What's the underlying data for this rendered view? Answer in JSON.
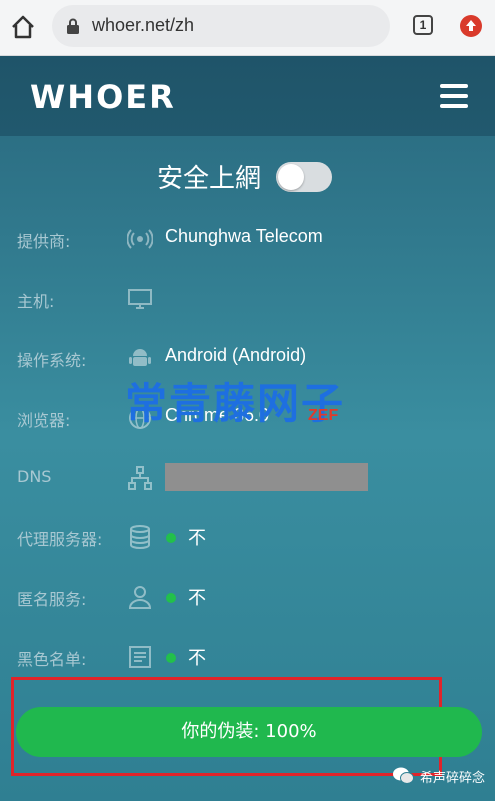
{
  "browser": {
    "url": "whoer.net/zh",
    "tab_count": "1"
  },
  "site": {
    "logo": "WHOER"
  },
  "secure": {
    "label": "安全上網",
    "toggle_on": false
  },
  "rows": [
    {
      "label": "提供商:",
      "icon": "signal-icon",
      "value": "Chunghwa Telecom"
    },
    {
      "label": "主机:",
      "icon": "monitor-icon",
      "value": ""
    },
    {
      "label": "操作系统:",
      "icon": "android-icon",
      "value": "Android (Android)"
    },
    {
      "label": "浏览器:",
      "icon": "globe-icon",
      "value": "Chrome 86.0"
    },
    {
      "label": "DNS",
      "icon": "network-icon",
      "value": ""
    },
    {
      "label": "代理服务器:",
      "icon": "database-icon",
      "value": "不"
    },
    {
      "label": "匿名服务:",
      "icon": "user-icon",
      "value": "不"
    },
    {
      "label": "黑色名单:",
      "icon": "list-icon",
      "value": "不"
    }
  ],
  "watermark": {
    "text": "常青藤网子",
    "accent": "ZEF"
  },
  "cta": {
    "label": "你的伪装: 100%",
    "percent": 100
  },
  "footer": {
    "wechat_label": "希声碎碎念"
  },
  "colors": {
    "header": "#1f5469",
    "panel": "#2f7f93",
    "status_green": "#22c04b",
    "cta": "#20b84e",
    "highlight": "#e0242a"
  }
}
